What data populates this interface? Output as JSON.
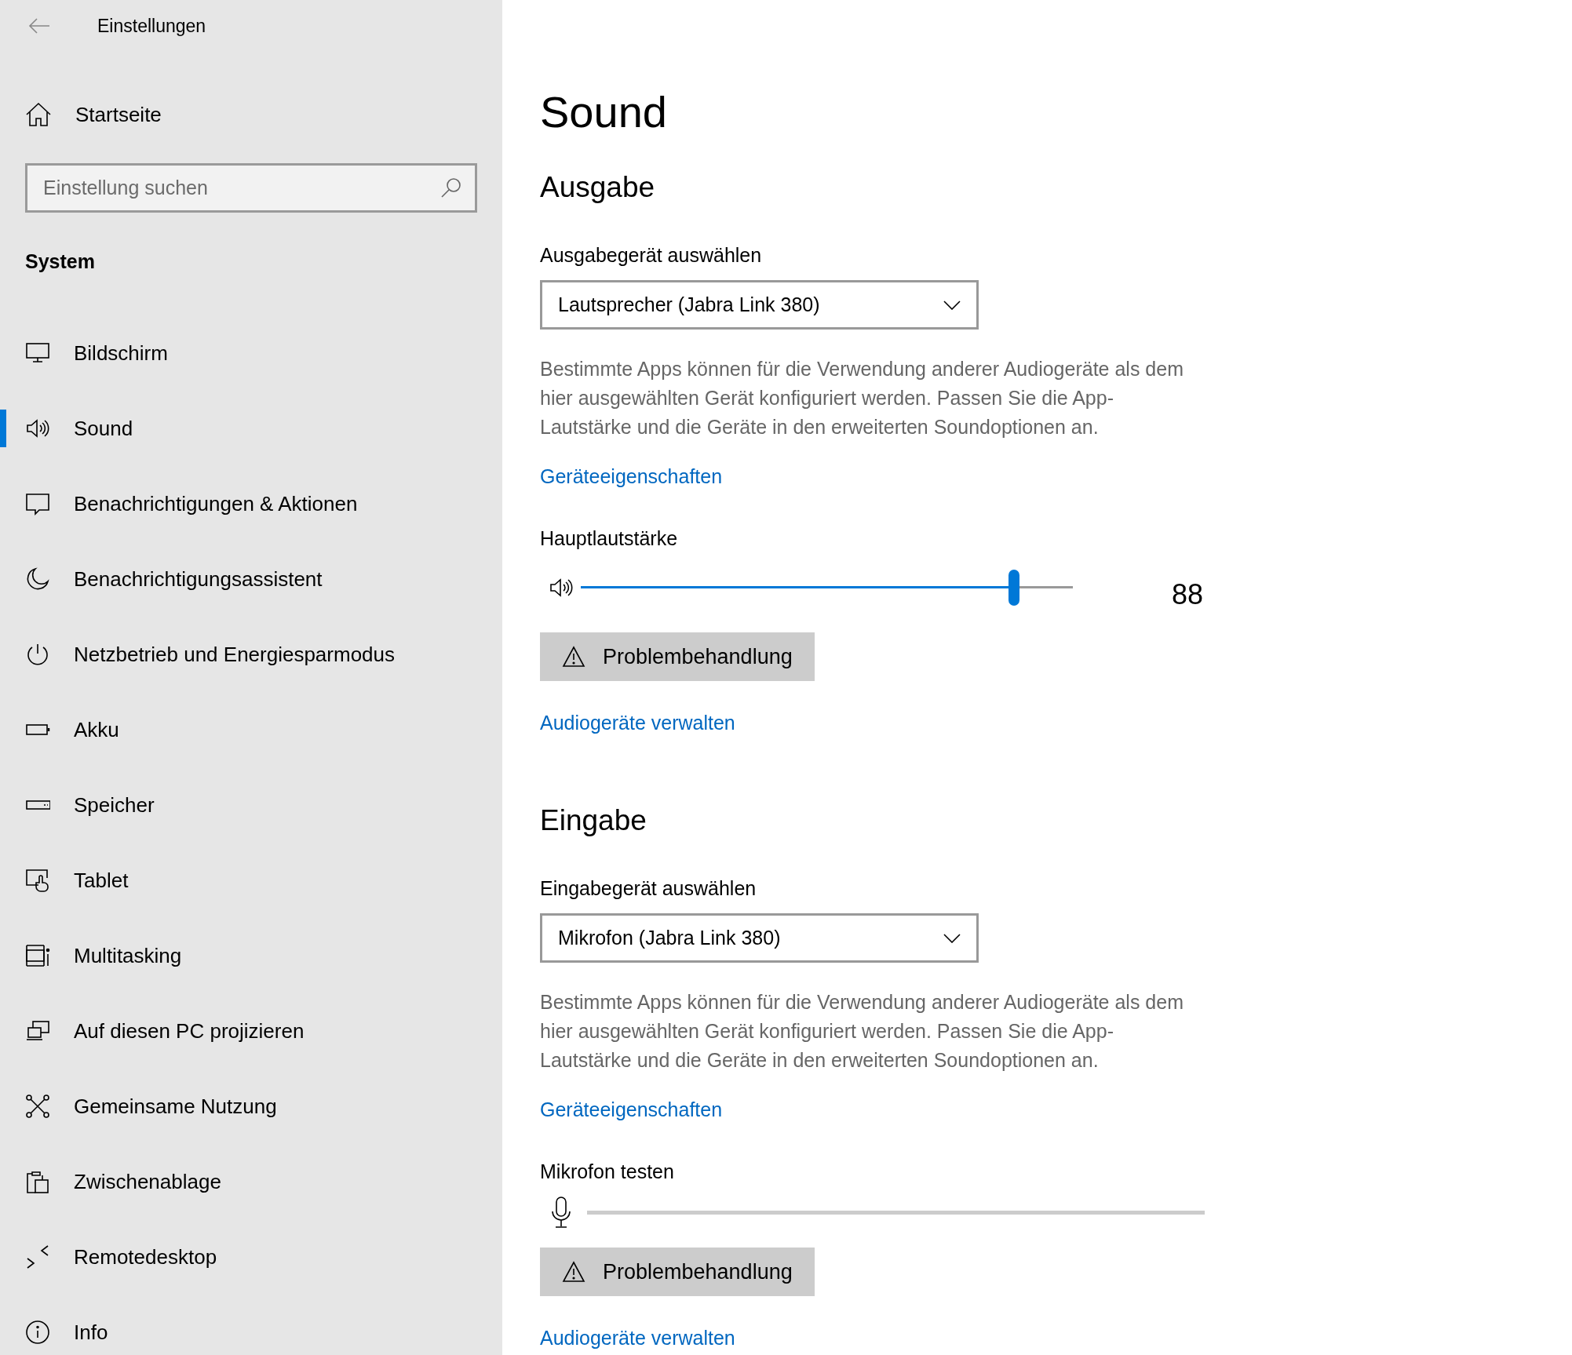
{
  "sidebar": {
    "app_title": "Einstellungen",
    "home": {
      "label": "Startseite"
    },
    "search": {
      "placeholder": "Einstellung suchen"
    },
    "section_heading": "System",
    "items": [
      {
        "label": "Bildschirm",
        "selected": false
      },
      {
        "label": "Sound",
        "selected": true
      },
      {
        "label": "Benachrichtigungen & Aktionen",
        "selected": false
      },
      {
        "label": "Benachrichtigungsassistent",
        "selected": false
      },
      {
        "label": "Netzbetrieb und Energiesparmodus",
        "selected": false
      },
      {
        "label": "Akku",
        "selected": false
      },
      {
        "label": "Speicher",
        "selected": false
      },
      {
        "label": "Tablet",
        "selected": false
      },
      {
        "label": "Multitasking",
        "selected": false
      },
      {
        "label": "Auf diesen PC projizieren",
        "selected": false
      },
      {
        "label": "Gemeinsame Nutzung",
        "selected": false
      },
      {
        "label": "Zwischenablage",
        "selected": false
      },
      {
        "label": "Remotedesktop",
        "selected": false
      },
      {
        "label": "Info",
        "selected": false
      }
    ]
  },
  "main": {
    "title": "Sound",
    "sections": [
      {
        "heading": "Ausgabe",
        "device_label": "Ausgabegerät auswählen",
        "device": "Lautsprecher (Jabra Link 380)",
        "description": "Bestimmte Apps können für die Verwendung anderer Audiogeräte als dem hier ausgewählten Gerät konfiguriert werden. Passen Sie die App-Lautstärke und die Geräte in den erweiterten Soundoptionen an.",
        "properties_link": "Geräteeigenschaften",
        "meter": {
          "kind": "volume",
          "label": "Hauptlautstärke",
          "level": 0.88,
          "reading": "88"
        },
        "troubleshoot_button": "Problembehandlung",
        "manage_link": "Audiogeräte verwalten"
      },
      {
        "heading": "Eingabe",
        "device_label": "Eingabegerät auswählen",
        "device": "Mikrofon (Jabra Link 380)",
        "description": "Bestimmte Apps können für die Verwendung anderer Audiogeräte als dem hier ausgewählten Gerät konfiguriert werden. Passen Sie die App-Lautstärke und die Geräte in den erweiterten Soundoptionen an.",
        "properties_link": "Geräteeigenschaften",
        "meter": {
          "kind": "mic-test",
          "label": "Mikrofon testen"
        },
        "troubleshoot_button": "Problembehandlung",
        "manage_link": "Audiogeräte verwalten"
      }
    ]
  }
}
